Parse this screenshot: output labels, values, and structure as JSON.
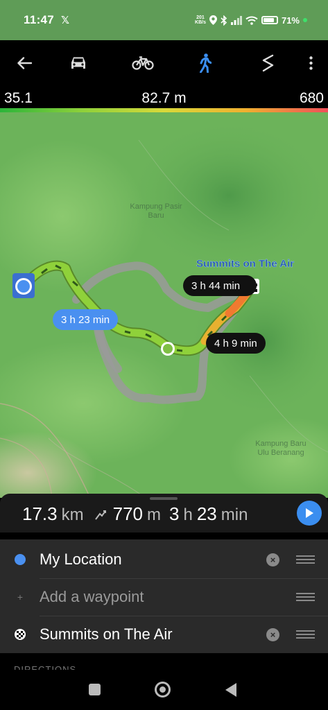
{
  "status_bar": {
    "time": "11:47",
    "x_icon": "x-logo-icon",
    "net_speed_value": "201",
    "net_speed_unit": "KB/s",
    "battery": "71%"
  },
  "toolbar": {
    "icons": [
      "back-arrow-icon",
      "car-icon",
      "bicycle-icon",
      "walking-icon",
      "route-icon",
      "more-vertical-icon"
    ],
    "active_mode": "walking",
    "active_color": "#3b8ef0"
  },
  "elevation": {
    "min": "35.1",
    "current": "82.7 m",
    "max": "680"
  },
  "map": {
    "labels": {
      "kampung_pasir": "Kampung Pasir",
      "baru": "Baru",
      "kampung_baru_ulu": "Kampung Baru",
      "ulu_beranang": "Ulu Beranang"
    },
    "destination_label": "Summits on The Air",
    "route_times": {
      "main": "3 h 23 min",
      "alt1": "3 h 44 min",
      "alt2": "4 h 9 min"
    }
  },
  "summary": {
    "distance_value": "17.3",
    "distance_unit": "km",
    "ascent_value": "770",
    "ascent_unit": "m",
    "hours": "3",
    "hours_unit": "h",
    "minutes": "23",
    "minutes_unit": "min"
  },
  "waypoints": {
    "start": "My Location",
    "add_placeholder": "Add a waypoint",
    "destination": "Summits on The Air"
  },
  "directions_label": "DIRECTIONS"
}
